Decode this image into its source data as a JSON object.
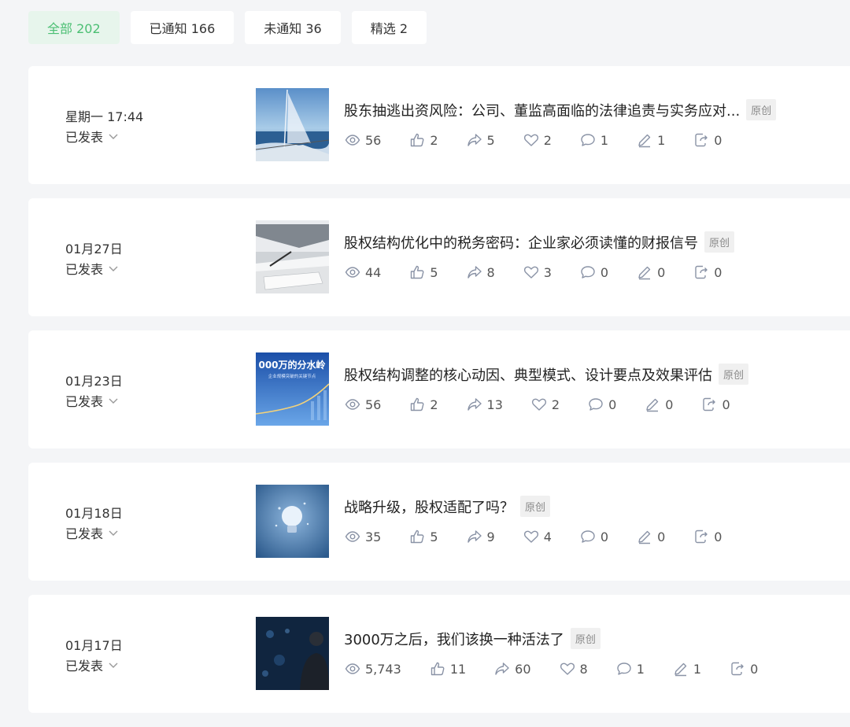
{
  "tabs": [
    {
      "label": "全部 202"
    },
    {
      "label": "已通知 166"
    },
    {
      "label": "未通知 36"
    },
    {
      "label": "精选 2"
    }
  ],
  "colors": {
    "accent": "#4bbf73",
    "icon": "#8a93a6",
    "badge_bg": "#f0f0f0"
  },
  "articles": [
    {
      "date": "星期一 17:44",
      "status": "已发表",
      "title": "股东抽逃出资风险：公司、董监高面临的法律追责与实务应对...",
      "badge": "原创",
      "thumb": "sailboat",
      "stats": {
        "views": "56",
        "likes": "2",
        "shares": "5",
        "favorites": "2",
        "comments": "1",
        "notes": "1",
        "forwards": "0"
      }
    },
    {
      "date": "01月27日",
      "status": "已发表",
      "title": "股权结构优化中的税务密码：企业家必须读懂的财报信号",
      "badge": "原创",
      "thumb": "documents",
      "stats": {
        "views": "44",
        "likes": "5",
        "shares": "8",
        "favorites": "3",
        "comments": "0",
        "notes": "0",
        "forwards": "0"
      }
    },
    {
      "date": "01月23日",
      "status": "已发表",
      "title": "股权结构调整的核心动因、典型模式、设计要点及效果评估",
      "badge": "原创",
      "thumb": "growth",
      "thumb_text": "000万的分水岭",
      "thumb_subtext": "企业规模突破的关键节点",
      "stats": {
        "views": "56",
        "likes": "2",
        "shares": "13",
        "favorites": "2",
        "comments": "0",
        "notes": "0",
        "forwards": "0"
      }
    },
    {
      "date": "01月18日",
      "status": "已发表",
      "title": "战略升级，股权适配了吗？",
      "badge": "原创",
      "thumb": "bulb",
      "stats": {
        "views": "35",
        "likes": "5",
        "shares": "9",
        "favorites": "4",
        "comments": "0",
        "notes": "0",
        "forwards": "0"
      }
    },
    {
      "date": "01月17日",
      "status": "已发表",
      "title": "3000万之后，我们该换一种活法了",
      "badge": "原创",
      "thumb": "person",
      "stats": {
        "views": "5,743",
        "likes": "11",
        "shares": "60",
        "favorites": "8",
        "comments": "1",
        "notes": "1",
        "forwards": "0"
      }
    }
  ]
}
